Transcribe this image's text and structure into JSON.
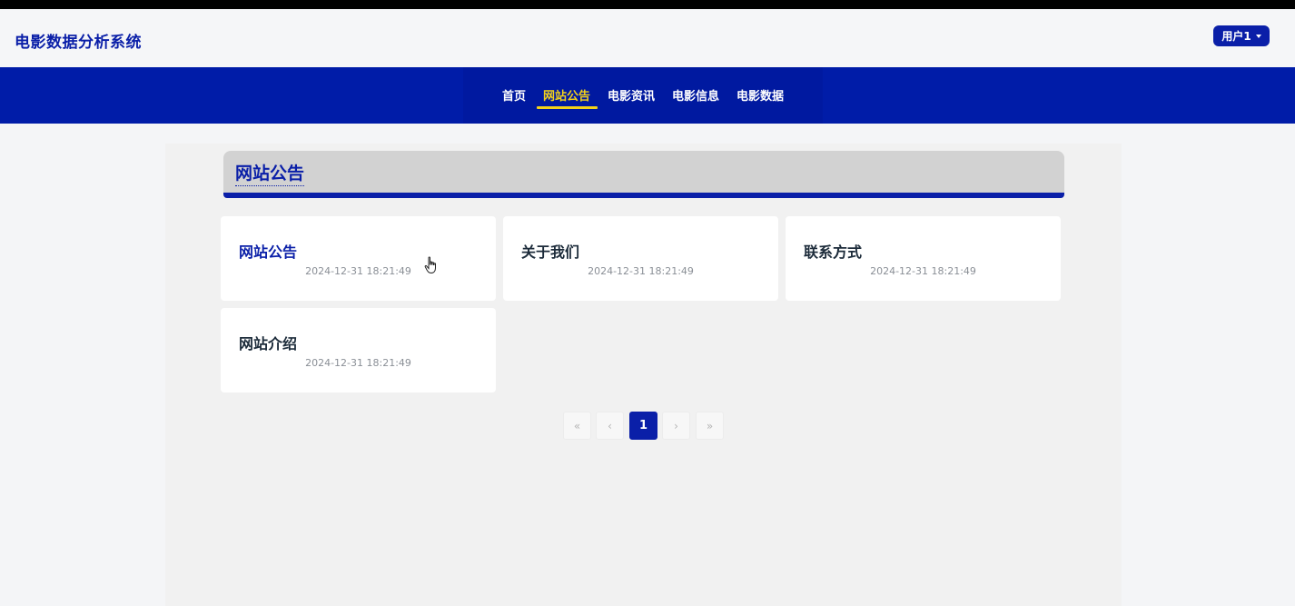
{
  "header": {
    "site_title": "电影数据分析系统",
    "user_label": "用户1"
  },
  "nav": {
    "items": [
      {
        "label": "首页",
        "active": false
      },
      {
        "label": "网站公告",
        "active": true
      },
      {
        "label": "电影资讯",
        "active": false
      },
      {
        "label": "电影信息",
        "active": false
      },
      {
        "label": "电影数据",
        "active": false
      }
    ]
  },
  "section": {
    "title": "网站公告"
  },
  "cards": [
    {
      "title": "网站公告",
      "date": "2024-12-31 18:21:49"
    },
    {
      "title": "关于我们",
      "date": "2024-12-31 18:21:49"
    },
    {
      "title": "联系方式",
      "date": "2024-12-31 18:21:49"
    },
    {
      "title": "网站介绍",
      "date": "2024-12-31 18:21:49"
    }
  ],
  "pagination": {
    "first": "«",
    "prev": "‹",
    "current": "1",
    "next": "›",
    "last": "»"
  },
  "colors": {
    "brand": "#0a1fa8",
    "nav_bg": "#001ca8",
    "accent": "#f3d21a"
  }
}
